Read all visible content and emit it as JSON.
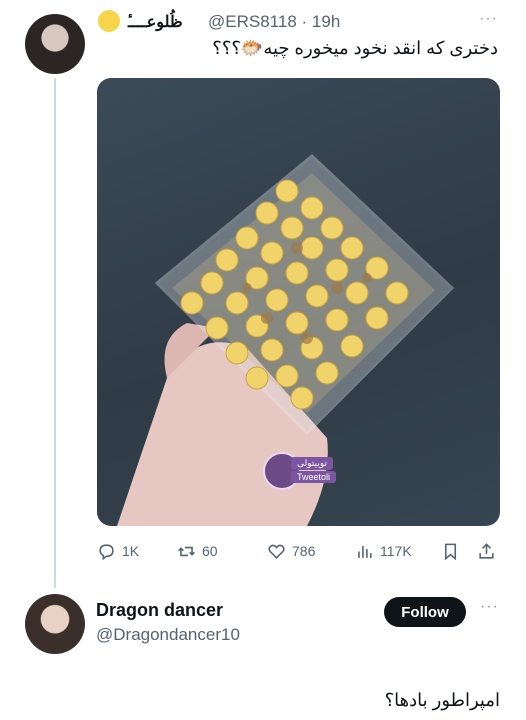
{
  "original_tweet": {
    "display_name": "ظُلوعــــٔ",
    "handle": "@ERS8118",
    "separator": "·",
    "time": "19h",
    "more_label": "···",
    "text": "دختری که انقد نخود میخوره چیه🐡؟؟؟",
    "watermark": {
      "line1": "توییتولی",
      "line2": "Tweetoli"
    },
    "stats": {
      "replies": "1K",
      "retweets": "60",
      "likes": "786",
      "views": "117K"
    }
  },
  "reply": {
    "display_name": "Dragon dancer",
    "handle": "@Dragondancer10",
    "follow_label": "Follow",
    "more_label": "···",
    "text": "امپراطور بادها؟"
  },
  "colors": {
    "text": "#0f1419",
    "muted": "#536471",
    "thread": "#cfd9de",
    "follow_bg": "#0f1419"
  },
  "icons": [
    "smile-emoji-icon",
    "reply-icon",
    "retweet-icon",
    "like-icon",
    "views-icon",
    "bookmark-icon",
    "share-icon"
  ]
}
